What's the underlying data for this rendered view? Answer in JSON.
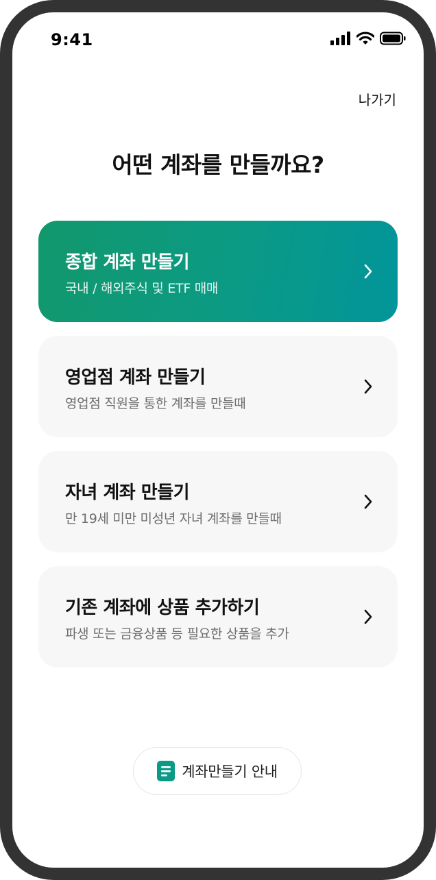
{
  "status_bar": {
    "time": "9:41"
  },
  "header": {
    "exit_label": "나가기"
  },
  "page": {
    "title": "어떤 계좌를 만들까요?"
  },
  "account_options": [
    {
      "title": "종합 계좌 만들기",
      "subtitle": "국내 / 해외주식 및 ETF 매매",
      "style": "primary"
    },
    {
      "title": "영업점 계좌 만들기",
      "subtitle": "영업점 직원을 통한 계좌를 만들때",
      "style": "default"
    },
    {
      "title": "자녀 계좌 만들기",
      "subtitle": "만 19세 미만 미성년 자녀 계좌를 만들때",
      "style": "default"
    },
    {
      "title": "기존 계좌에 상품 추가하기",
      "subtitle": "파생 또는 금융상품 등 필요한 상품을 추가",
      "style": "default"
    }
  ],
  "guide_button": {
    "label": "계좌만들기 안내",
    "icon": "document-icon"
  },
  "colors": {
    "accent_start": "#12986c",
    "accent_end": "#02959a",
    "card_background": "#f7f7f7",
    "frame": "#333333"
  }
}
